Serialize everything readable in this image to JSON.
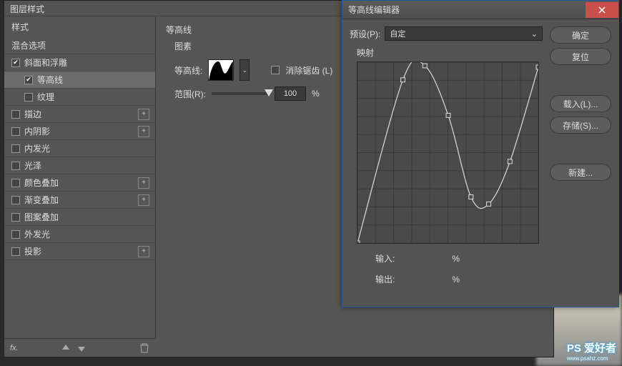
{
  "main_panel": {
    "title": "图层样式",
    "styles_header": "样式",
    "blending_options": "混合选项",
    "items": [
      {
        "label": "斜面和浮雕",
        "checked": true,
        "sub": false,
        "plus": false
      },
      {
        "label": "等高线",
        "checked": true,
        "sub": true,
        "selected": true,
        "plus": false
      },
      {
        "label": "纹理",
        "checked": false,
        "sub": true,
        "plus": false
      },
      {
        "label": "描边",
        "checked": false,
        "sub": false,
        "plus": true
      },
      {
        "label": "内阴影",
        "checked": false,
        "sub": false,
        "plus": true
      },
      {
        "label": "内发光",
        "checked": false,
        "sub": false,
        "plus": false
      },
      {
        "label": "光泽",
        "checked": false,
        "sub": false,
        "plus": false
      },
      {
        "label": "颜色叠加",
        "checked": false,
        "sub": false,
        "plus": true
      },
      {
        "label": "渐变叠加",
        "checked": false,
        "sub": false,
        "plus": true
      },
      {
        "label": "图案叠加",
        "checked": false,
        "sub": false,
        "plus": false
      },
      {
        "label": "外发光",
        "checked": false,
        "sub": false,
        "plus": false
      },
      {
        "label": "投影",
        "checked": false,
        "sub": false,
        "plus": true
      }
    ],
    "content": {
      "section": "等高线",
      "subsection": "图素",
      "contour_label": "等高线:",
      "antialias_label": "消除锯齿 (L)",
      "range_label": "范围(R):",
      "range_value": "100",
      "percent": "%"
    }
  },
  "dialog": {
    "title": "等高线编辑器",
    "preset_label": "预设(P):",
    "preset_value": "自定",
    "mapping_label": "映射",
    "input_label": "输入:",
    "output_label": "输出:",
    "percent": "%",
    "buttons": {
      "ok": "确定",
      "reset": "复位",
      "load": "载入(L)...",
      "save": "存储(S)...",
      "new": "新建..."
    }
  },
  "watermark": {
    "main": "PS 爱好者",
    "sub": "www.psahz.com"
  },
  "chart_data": {
    "type": "line",
    "title": "等高线曲线",
    "xlabel": "输入",
    "ylabel": "输出",
    "xlim": [
      0,
      255
    ],
    "ylim": [
      0,
      255
    ],
    "points": [
      {
        "x": 0,
        "y": 0
      },
      {
        "x": 64,
        "y": 230
      },
      {
        "x": 95,
        "y": 250
      },
      {
        "x": 128,
        "y": 180
      },
      {
        "x": 160,
        "y": 65
      },
      {
        "x": 185,
        "y": 55
      },
      {
        "x": 215,
        "y": 115
      },
      {
        "x": 255,
        "y": 248
      }
    ]
  }
}
